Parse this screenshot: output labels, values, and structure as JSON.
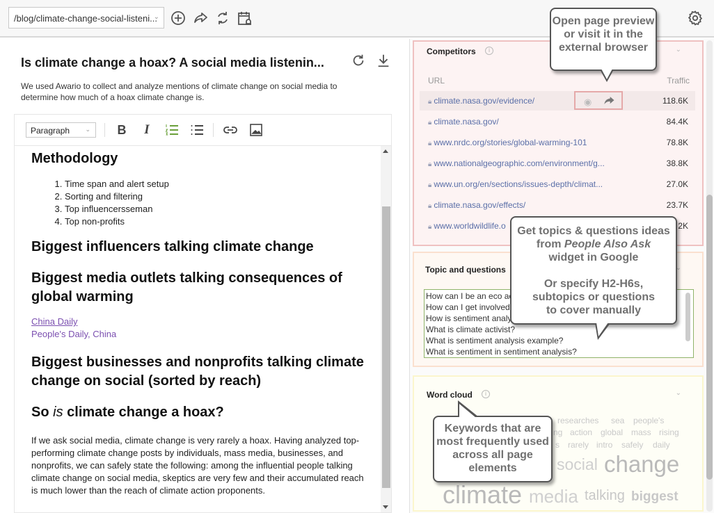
{
  "topbar": {
    "url_value": "/blog/climate-change-social-listeni...",
    "icons": [
      "add-circle-icon",
      "share-icon",
      "sync-icon",
      "calendar-alert-icon"
    ],
    "settings_icon": "gear-icon"
  },
  "document": {
    "title": "Is climate change a hoax? A social media listenin...",
    "description": "We used Awario to collect and analyze mentions of climate change on social media to determine how much of a hoax climate change is."
  },
  "editor": {
    "format_select": "Paragraph",
    "tools": [
      "bold",
      "italic",
      "numbered-list",
      "bulleted-list",
      "link",
      "image"
    ],
    "content": {
      "h_methodology": "Methodology",
      "methodology_items": [
        "Time span and alert setup",
        "Sorting and filtering",
        "Top influencersseman",
        "Top non-profits"
      ],
      "h_influencers": "Biggest influencers talking climate change",
      "h_media": "Biggest media outlets talking consequences of global warming",
      "link_china_daily": "China Daily",
      "link_peoples_daily": "People's Daily, China",
      "h_businesses": "Biggest businesses and nonprofits talking climate change on social (sorted by reach)",
      "h_hoax_pre": "So ",
      "h_hoax_em": "is",
      "h_hoax_post": " climate change a hoax?",
      "conclusion": "If we ask social media, climate change is very rarely a hoax. Having analyzed top-performing climate change posts by individuals, mass media, businesses, and nonprofits, we can safely state the following: among the influential people talking climate change on social media, skeptics are very few and their accumulated reach is much lower than the reach of climate action proponents."
    }
  },
  "competitors": {
    "title": "Competitors",
    "col_url": "URL",
    "col_traffic": "Traffic",
    "rows": [
      {
        "url": "climate.nasa.gov/evidence/",
        "traffic": "118.6K"
      },
      {
        "url": "climate.nasa.gov/",
        "traffic": "84.4K"
      },
      {
        "url": "www.nrdc.org/stories/global-warming-101",
        "traffic": "78.8K"
      },
      {
        "url": "www.nationalgeographic.com/environment/g...",
        "traffic": "38.8K"
      },
      {
        "url": "www.un.org/en/sections/issues-depth/climat...",
        "traffic": "27.0K"
      },
      {
        "url": "climate.nasa.gov/effects/",
        "traffic": "23.7K"
      },
      {
        "url": "www.worldwildlife.o",
        "traffic": "2K"
      }
    ]
  },
  "topics": {
    "title": "Topic and questions",
    "questions": [
      "How can I be an eco ac",
      "How can I get involved",
      "How is sentiment analy",
      "What is climate activist?",
      "What is sentiment analysis example?",
      "What is sentiment in sentiment analysis?"
    ]
  },
  "wordcloud": {
    "title": "Word cloud",
    "words": {
      "researches": "researches",
      "sea": "sea",
      "peoples": "people's",
      "ng": "ng",
      "action": "action",
      "global": "global",
      "mass": "mass",
      "rising": "rising",
      "s": "s",
      "rarely": "rarely",
      "intro": "intro",
      "safely": "safely",
      "daily": "daily",
      "social": "social",
      "change": "change",
      "climate": "climate",
      "media": "media",
      "talking": "talking",
      "biggest": "biggest"
    }
  },
  "callouts": {
    "preview": "Open page preview or visit it in the external browser",
    "topics_line1": "Get topics & questions ideas",
    "topics_line2_pre": "from ",
    "topics_line2_em": "People Also Ask",
    "topics_line3": "widget in Google",
    "topics_line4": "Or specify H2-H6s,",
    "topics_line5": "subtopics or questions",
    "topics_line6": "to cover manually",
    "keywords": "Keywords that are most frequently used across all page elements"
  }
}
